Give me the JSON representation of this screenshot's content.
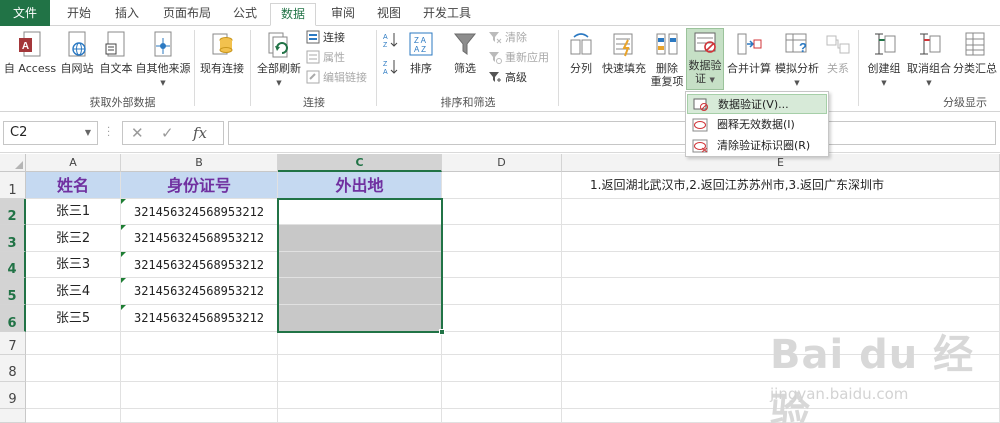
{
  "tabs": [
    "文件",
    "开始",
    "插入",
    "页面布局",
    "公式",
    "数据",
    "审阅",
    "视图",
    "开发工具"
  ],
  "active_tab": "数据",
  "ribbon": {
    "get_external": {
      "label": "获取外部数据",
      "access": "自 Access",
      "web": "自网站",
      "text": "自文本",
      "other": "自其他来源",
      "existing": "现有连接"
    },
    "connections": {
      "label": "连接",
      "refresh_all": "全部刷新",
      "connections": "连接",
      "properties": "属性",
      "edit_links": "编辑链接"
    },
    "sort_filter": {
      "label": "排序和筛选",
      "sort": "排序",
      "filter": "筛选",
      "clear": "清除",
      "reapply": "重新应用",
      "advanced": "高级"
    },
    "data_tools": {
      "text_to_columns": "分列",
      "flash_fill": "快速填充",
      "remove_dup_1": "删除",
      "remove_dup_2": "重复项",
      "validation_1": "数据验",
      "validation_2": "证",
      "consolidate": "合并计算",
      "what_if": "模拟分析",
      "relationships": "关系"
    },
    "outline": {
      "label": "分级显示",
      "group": "创建组",
      "ungroup": "取消组合",
      "subtotal": "分类汇总"
    }
  },
  "dropdown": {
    "items": [
      "数据验证(V)...",
      "圈释无效数据(I)",
      "清除验证标识圈(R)"
    ]
  },
  "formula_bar": {
    "name_box": "C2",
    "fx": "fx"
  },
  "sheet": {
    "columns": [
      "A",
      "B",
      "C",
      "D",
      "E"
    ],
    "rows": [
      "1",
      "2",
      "3",
      "4",
      "5",
      "6",
      "7",
      "8",
      "9"
    ],
    "headers": [
      "姓名",
      "身份证号",
      "外出地"
    ],
    "names": [
      "张三1",
      "张三2",
      "张三3",
      "张三4",
      "张三5"
    ],
    "ids": [
      "321456324568953212",
      "321456324568953212",
      "321456324568953212",
      "321456324568953212",
      "321456324568953212"
    ],
    "note": "1.返回湖北武汉市,2.返回江苏苏州市,3.返回广东深圳市"
  },
  "watermark": {
    "main": "Bai du 经验",
    "sub": "jingyan.baidu.com"
  },
  "colors": {
    "accent": "#217346",
    "header_fill": "#c5d9f1",
    "header_text": "#7030a0",
    "selection_fill": "#c8c8c8"
  }
}
